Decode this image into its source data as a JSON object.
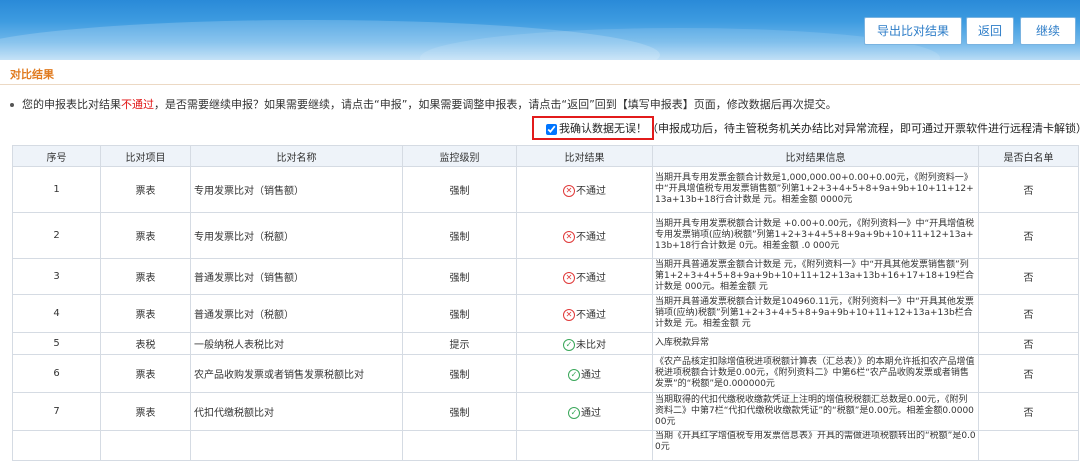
{
  "toolbar": {
    "export_label": "导出比对结果",
    "back_label": "返回",
    "continue_label": "继续"
  },
  "section_title": "对比结果",
  "notice": {
    "part1": "您的申报表比对结果",
    "highlight": "不通过",
    "part2": "，是否需要继续申报？如果需要继续，请点击“申报”，如果需要调整申报表，请点击“返回”回到【填写申报表】页面，修改数据后再次提交。"
  },
  "confirm": {
    "label": "我确认数据无误！（申报成功后，待主管税务机关办结比对异常流程，即可通过开票软件进行远程清卡解锁）",
    "checked": true
  },
  "table": {
    "headers": [
      "序号",
      "比对项目",
      "比对名称",
      "监控级别",
      "比对结果",
      "比对结果信息",
      "是否白名单"
    ],
    "rows": [
      {
        "no": "1",
        "item": "票表",
        "name": "专用发票比对（销售额）",
        "level": "强制",
        "result": "不通过",
        "status": "fail",
        "info": "当期开具专用发票金额合计数是1,000,000.00+0.00+0.00元，《附列资料一》中“开具增值税专用发票销售额”列第1+2+3+4+5+8+9a+9b+10+11+12+13a+13b+18行合计数是 元。相差金额 0000元",
        "white": "否"
      },
      {
        "no": "2",
        "item": "票表",
        "name": "专用发票比对（税额）",
        "level": "强制",
        "result": "不通过",
        "status": "fail",
        "info": "当期开具专用发票税额合计数是 +0.00+0.00元，《附列资料一》中“开具增值税专用发票销项(应纳)税额”列第1+2+3+4+5+8+9a+9b+10+11+12+13a+13b+18行合计数是 0元。相差金额 .0 000元",
        "white": "否"
      },
      {
        "no": "3",
        "item": "票表",
        "name": "普通发票比对（销售额）",
        "level": "强制",
        "result": "不通过",
        "status": "fail",
        "info": "当期开具普通发票金额合计数是 元，《附列资料一》中“开具其他发票销售额”列第1+2+3+4+5+8+9a+9b+10+11+12+13a+13b+16+17+18+19栏合计数是 000元。相差金额 元",
        "white": "否"
      },
      {
        "no": "4",
        "item": "票表",
        "name": "普通发票比对（税额）",
        "level": "强制",
        "result": "不通过",
        "status": "fail",
        "info": "当期开具普通发票税额合计数是104960.11元，《附列资料一》中“开具其他发票销项(应纳)税额”列第1+2+3+4+5+8+9a+9b+10+11+12+13a+13b栏合计数是 元。相差金额 元",
        "white": "否"
      },
      {
        "no": "5",
        "item": "表税",
        "name": "一般纳税人表税比对",
        "level": "提示",
        "result": "未比对",
        "status": "pass",
        "info": "入库税款异常",
        "white": "否"
      },
      {
        "no": "6",
        "item": "票表",
        "name": "农产品收购发票或者销售发票税额比对",
        "level": "强制",
        "result": "通过",
        "status": "pass",
        "info": "《农产品核定扣除增值税进项税额计算表（汇总表）》的本期允许抵扣农产品增值税进项税额合计数是0.00元，《附列资料二》中第6栏“农产品收购发票或者销售发票”的“税额”是0.000000元",
        "white": "否"
      },
      {
        "no": "7",
        "item": "票表",
        "name": "代扣代缴税额比对",
        "level": "强制",
        "result": "通过",
        "status": "pass",
        "info": "当期取得的代扣代缴税收缴款凭证上注明的增值税税额汇总数是0.00元，《附列资料二》中第7栏“代扣代缴税收缴款凭证”的“税额”是0.00元。相差金额0.000000元",
        "white": "否"
      }
    ],
    "partial_row_info": "当期《开具红字增值税专用发票信息表》开具的需做进项税额转出的“税额”是0.00元"
  }
}
